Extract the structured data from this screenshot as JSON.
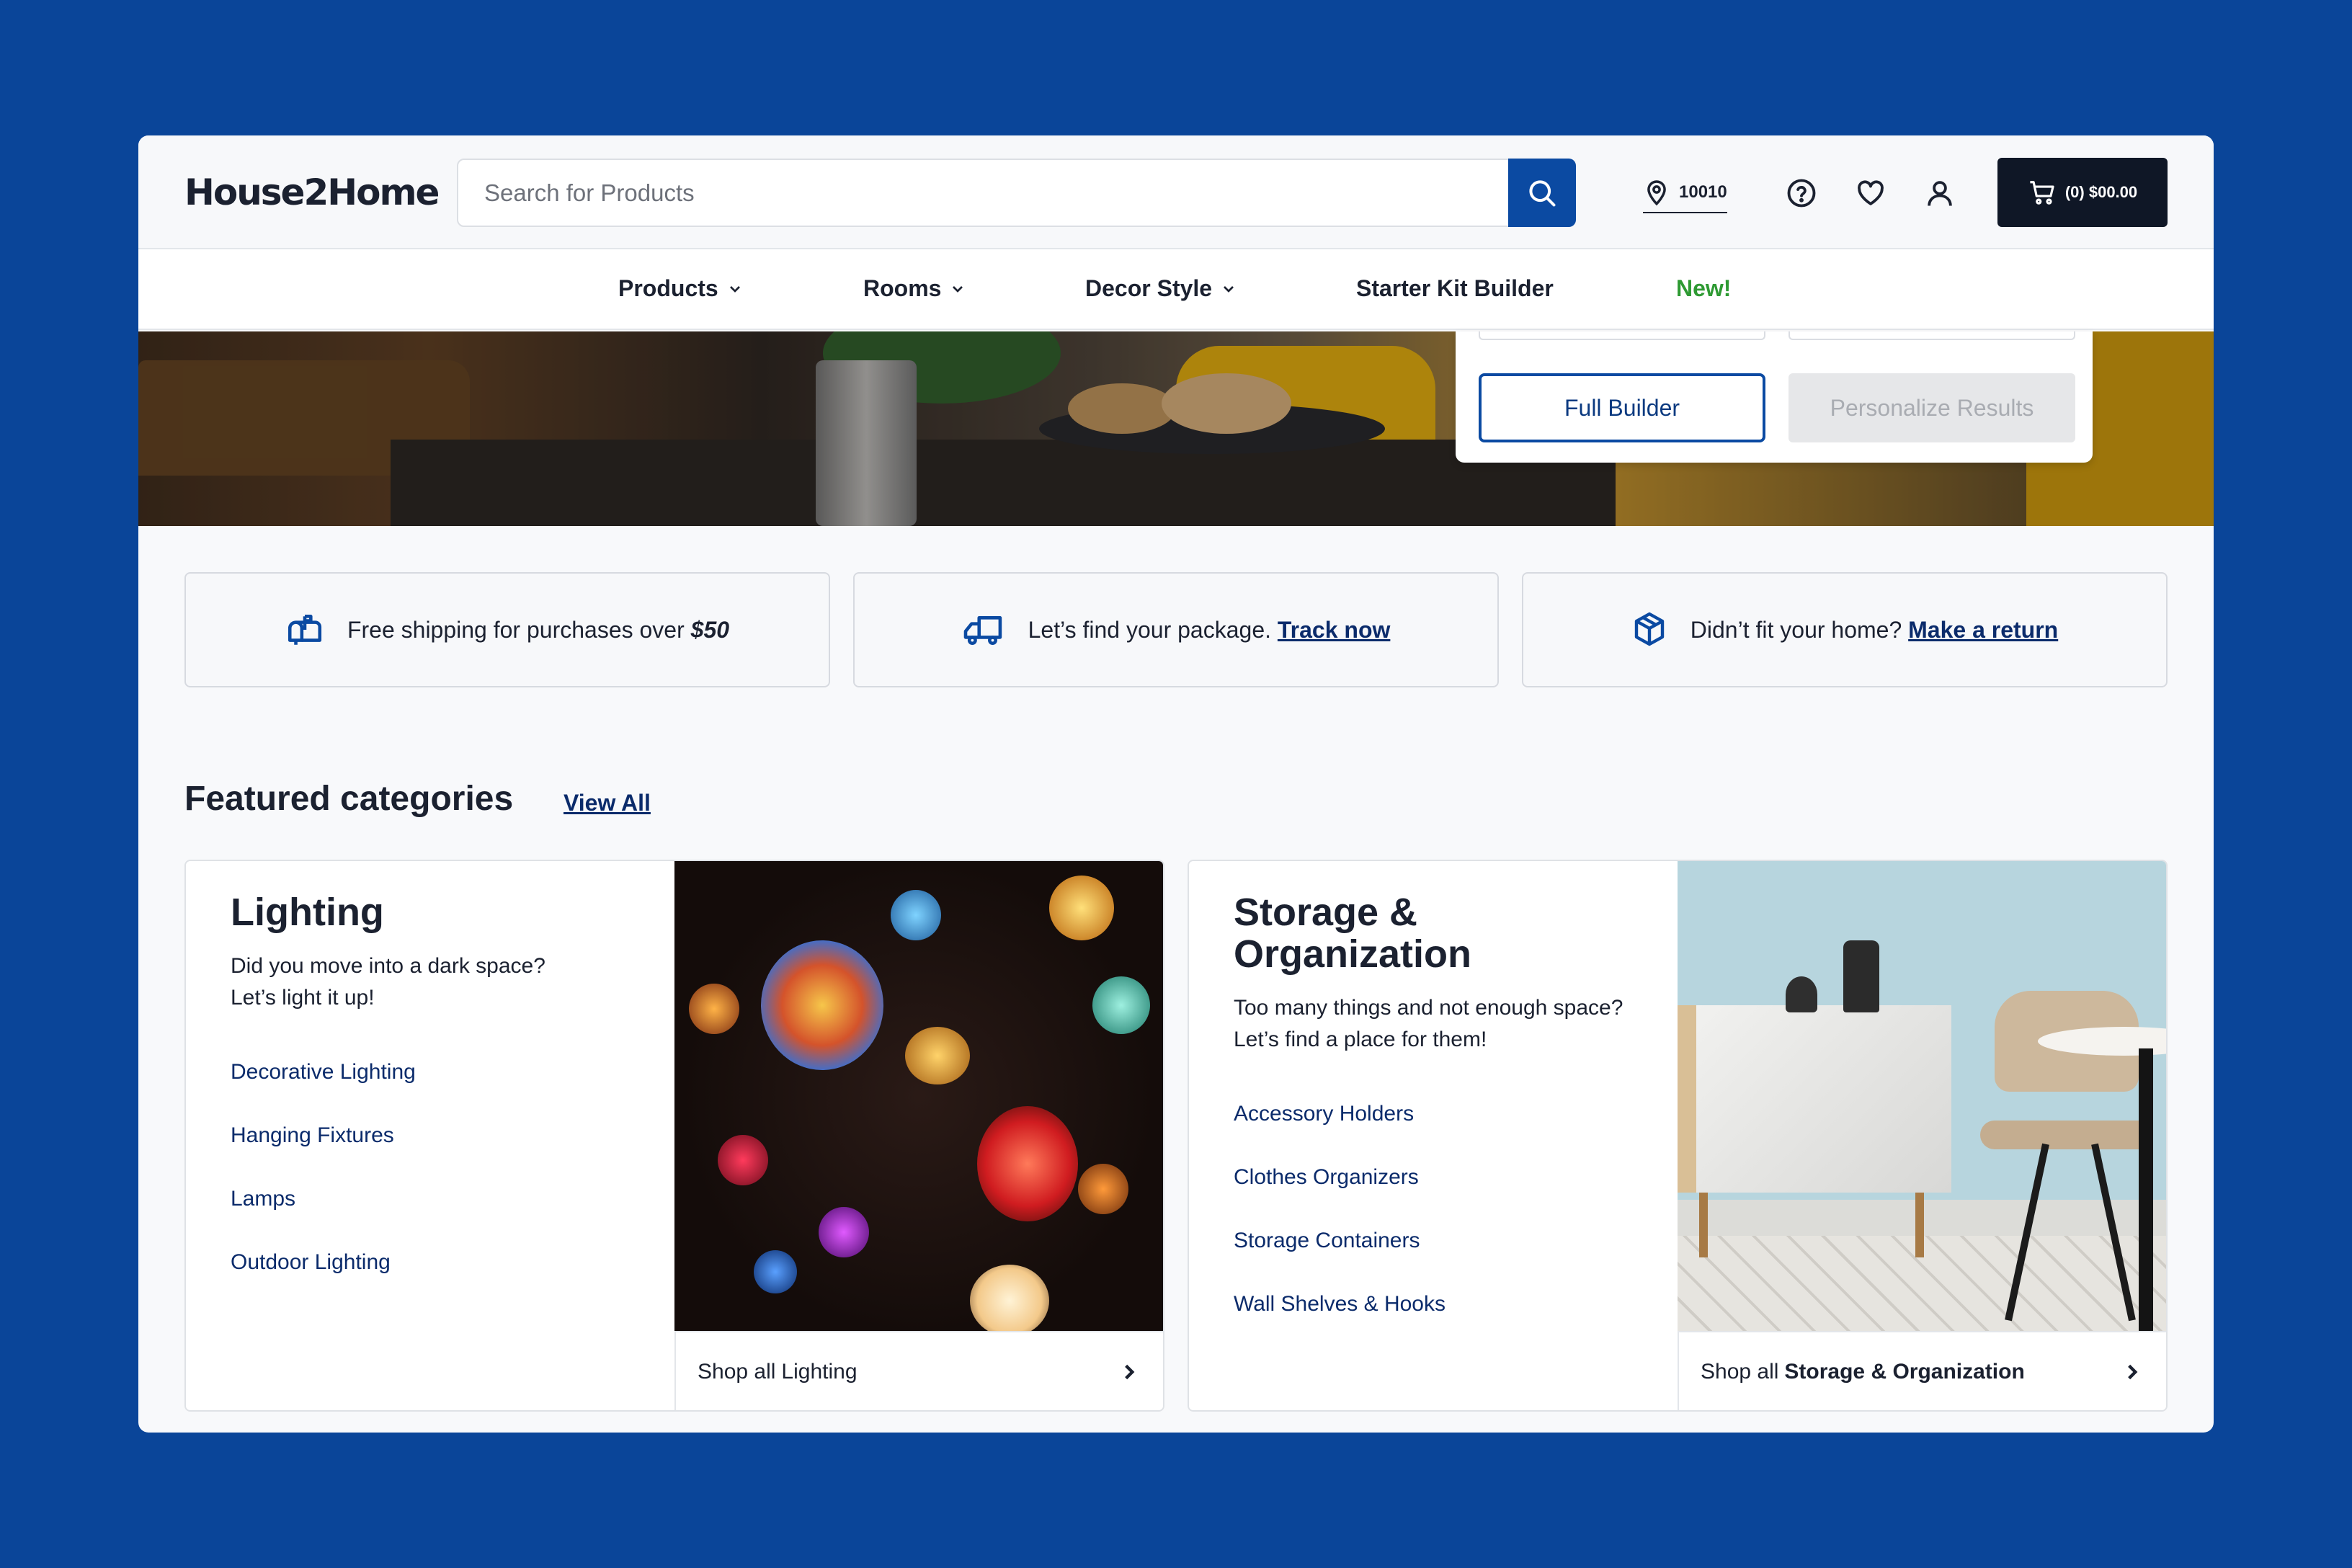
{
  "brand": {
    "logo": "House2Home"
  },
  "search": {
    "placeholder": "Search for Products"
  },
  "header": {
    "zip": "10010",
    "cart_label": "(0) $00.00"
  },
  "nav": {
    "items": [
      {
        "label": "Products"
      },
      {
        "label": "Rooms"
      },
      {
        "label": "Decor Style"
      },
      {
        "label": "Starter Kit Builder"
      },
      {
        "label": "New!"
      }
    ]
  },
  "builder": {
    "full_label": "Full Builder",
    "personalize_label": "Personalize Results"
  },
  "info": {
    "shipping_text": "Free shipping for purchases over ",
    "shipping_amount": "$50",
    "track_text": "Let’s find your package. ",
    "track_link": "Track now",
    "return_text": "Didn’t fit your home? ",
    "return_link": "Make a return"
  },
  "featured": {
    "title": "Featured categories",
    "view_all": "View All",
    "cards": [
      {
        "title": "Lighting",
        "desc_line1": "Did you move into a dark space?",
        "desc_line2": "Let’s light it up!",
        "links": [
          "Decorative Lighting",
          "Hanging Fixtures",
          "Lamps",
          "Outdoor Lighting"
        ],
        "shop_prefix": "Shop all",
        "shop_name": "Lighting"
      },
      {
        "title_line1": "Storage &",
        "title_line2": "Organization",
        "desc_line1": "Too many things and not enough space?",
        "desc_line2": "Let’s find a place for them!",
        "links": [
          "Accessory Holders",
          "Clothes Organizers",
          "Storage Containers",
          "Wall Shelves & Hooks"
        ],
        "shop_prefix": "Shop all",
        "shop_name": "Storage & Organization"
      }
    ]
  },
  "colors": {
    "brand_blue": "#0b4aa2",
    "background": "#0a4599",
    "new_green": "#2e9a33",
    "cart_bg": "#0f1726"
  },
  "icons": [
    "search-icon",
    "location-pin-icon",
    "help-icon",
    "heart-icon",
    "user-icon",
    "cart-icon",
    "chevron-down-icon",
    "mailbox-icon",
    "truck-icon",
    "box-icon",
    "chevron-right-icon"
  ]
}
